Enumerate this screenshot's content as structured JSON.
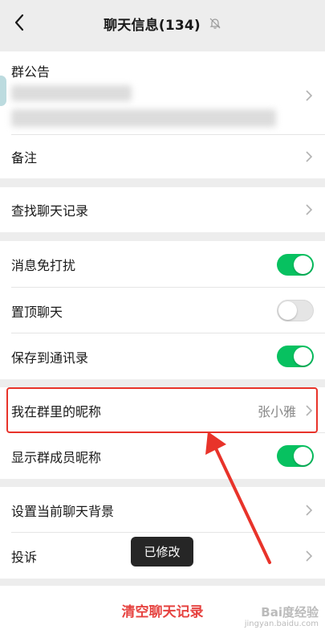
{
  "nav": {
    "title": "聊天信息(134)",
    "back_icon": "chevron-left-icon",
    "mute_icon": "bell-muted-icon"
  },
  "group_notice": {
    "label": "群公告"
  },
  "remark": {
    "label": "备注"
  },
  "search_history": {
    "label": "查找聊天记录"
  },
  "settings": [
    {
      "label": "消息免打扰",
      "state": "on"
    },
    {
      "label": "置顶聊天",
      "state": "off"
    },
    {
      "label": "保存到通讯录",
      "state": "on"
    }
  ],
  "nickname": {
    "label": "我在群里的昵称",
    "value": "张小雅"
  },
  "show_nicknames": {
    "label": "显示群成员昵称",
    "state": "on"
  },
  "background": {
    "label": "设置当前聊天背景"
  },
  "complaint": {
    "label": "投诉"
  },
  "toast": {
    "text": "已修改"
  },
  "clear": {
    "label": "清空聊天记录"
  },
  "watermark": {
    "line1": "Bai度经验",
    "line2": "jingyan.baidu.com"
  },
  "colors": {
    "accent_green": "#07c160",
    "danger_red": "#e64340",
    "annotation_red": "#e8332a"
  }
}
